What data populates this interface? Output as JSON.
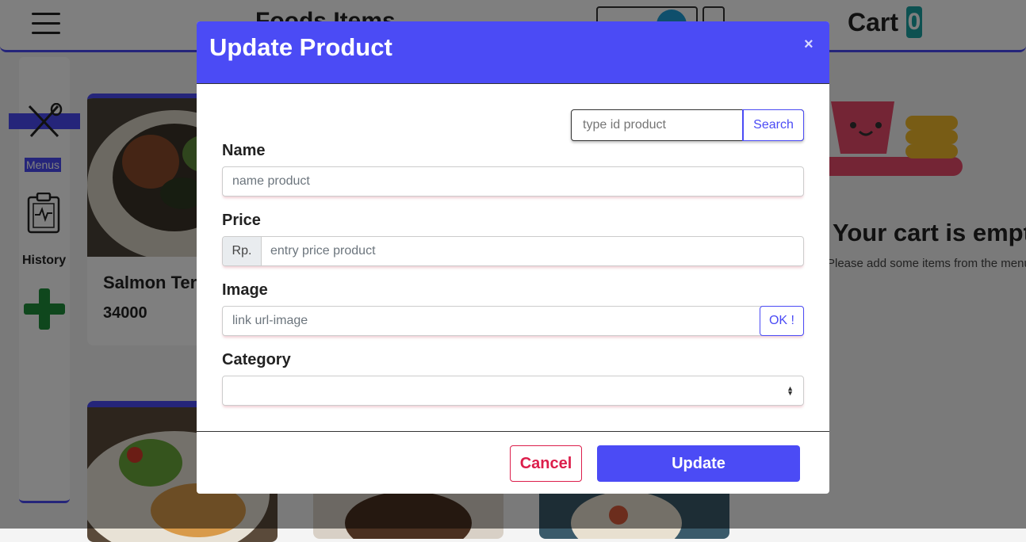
{
  "header": {
    "title": "Foods Items",
    "cart_label": "Cart",
    "cart_count": "0"
  },
  "sidebar": {
    "items": [
      {
        "label": "Menus",
        "icon": "fork-knife-icon"
      },
      {
        "label": "History",
        "icon": "clipboard-icon"
      },
      {
        "label": "",
        "icon": "plus-icon"
      }
    ]
  },
  "products": [
    {
      "name": "Salmon Teriyaki",
      "price": "34000"
    }
  ],
  "cart": {
    "empty_title": "Your cart is empty",
    "empty_subtitle": "Please add some items from the menu"
  },
  "modal": {
    "title": "Update Product",
    "close_symbol": "×",
    "search": {
      "placeholder": "type id product",
      "button": "Search"
    },
    "name": {
      "label": "Name",
      "placeholder": "name product"
    },
    "price": {
      "label": "Price",
      "prefix": "Rp.",
      "placeholder": "entry price product"
    },
    "image": {
      "label": "Image",
      "placeholder": "link url-image",
      "button": "OK !"
    },
    "category": {
      "label": "Category",
      "value": ""
    },
    "cancel_label": "Cancel",
    "update_label": "Update"
  },
  "colors": {
    "accent": "#4b4bf5",
    "danger": "#dc1e4b",
    "badge": "#1aa3a3"
  }
}
